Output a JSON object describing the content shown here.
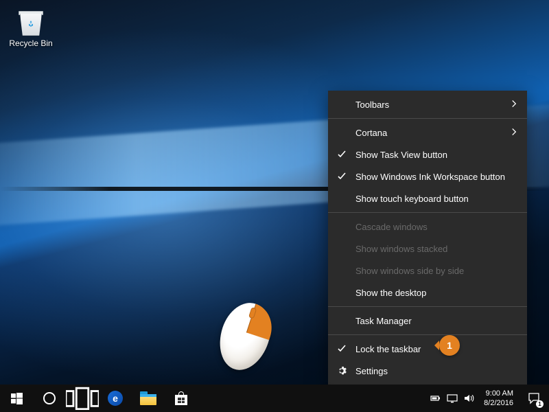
{
  "desktop": {
    "recycle_bin_label": "Recycle Bin"
  },
  "context_menu": {
    "toolbars": "Toolbars",
    "cortana": "Cortana",
    "show_task_view": "Show Task View button",
    "show_ink": "Show Windows Ink Workspace button",
    "show_touch_kb": "Show touch keyboard button",
    "cascade": "Cascade windows",
    "stacked": "Show windows stacked",
    "side_by_side": "Show windows side by side",
    "show_desktop": "Show the desktop",
    "task_manager": "Task Manager",
    "lock_taskbar": "Lock the taskbar",
    "settings": "Settings"
  },
  "tray": {
    "time": "9:00 AM",
    "date": "8/2/2016",
    "notification_count": "1"
  },
  "annotations": {
    "step1": "1",
    "step1_taskbar": "1"
  }
}
